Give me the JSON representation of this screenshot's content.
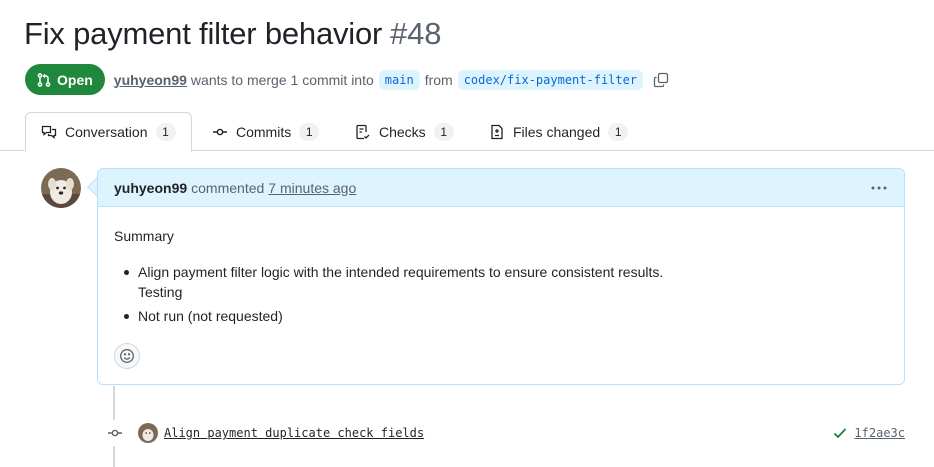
{
  "pr": {
    "title": "Fix payment filter behavior",
    "number": "#48",
    "state": "Open",
    "author": "yuhyeon99",
    "merge_text": "wants to merge 1 commit into",
    "base_branch": "main",
    "from_text": "from",
    "head_branch": "codex/fix-payment-filter"
  },
  "tabs": [
    {
      "label": "Conversation",
      "count": "1",
      "icon": "comment-discussion-icon"
    },
    {
      "label": "Commits",
      "count": "1",
      "icon": "git-commit-icon"
    },
    {
      "label": "Checks",
      "count": "1",
      "icon": "checklist-icon"
    },
    {
      "label": "Files changed",
      "count": "1",
      "icon": "file-diff-icon"
    }
  ],
  "comment": {
    "author": "yuhyeon99",
    "action": "commented",
    "time": "7 minutes ago",
    "summary_heading": "Summary",
    "bullet_1_line_1": "Align payment filter logic with the intended requirements to ensure consistent results.",
    "bullet_1_line_2": "Testing",
    "bullet_2": "Not run (not requested)"
  },
  "commit": {
    "message": "Align payment duplicate check fields",
    "sha": "1f2ae3c",
    "status": "success"
  },
  "colors": {
    "open_green": "#1f883d",
    "link_blue": "#0969da",
    "comment_header_bg": "#ddf4ff",
    "check_green": "#1a7f37"
  }
}
